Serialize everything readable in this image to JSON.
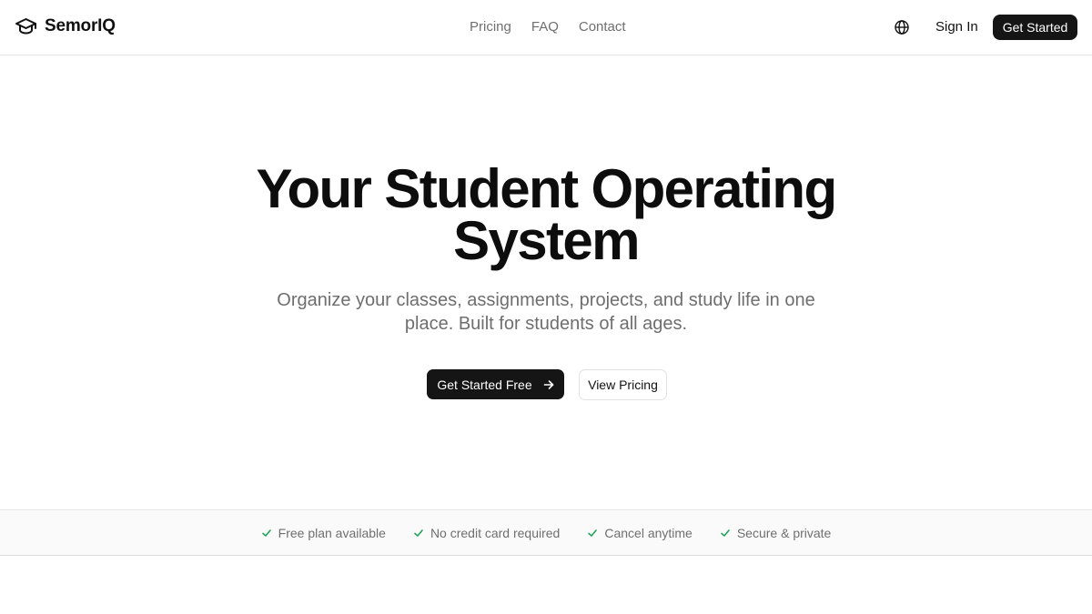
{
  "brand": {
    "name": "SemorIQ",
    "icon": "graduation-cap-icon"
  },
  "nav": {
    "links": [
      "Pricing",
      "FAQ",
      "Contact"
    ],
    "language_icon": "globe-icon",
    "sign_in_label": "Sign In",
    "get_started_label": "Get Started"
  },
  "hero": {
    "title": "Your Student Operating System",
    "subtitle": "Organize your classes, assignments, projects, and study life in one place. Built for students of all ages.",
    "primary_cta": "Get Started Free",
    "primary_cta_icon": "arrow-right-icon",
    "secondary_cta": "View Pricing"
  },
  "features": {
    "icon": "check-icon",
    "items": [
      "Free plan available",
      "No credit card required",
      "Cancel anytime",
      "Secure & private"
    ]
  },
  "colors": {
    "primary_button": "#151515",
    "check": "#22a35a",
    "muted_text": "#6f6f6f"
  }
}
